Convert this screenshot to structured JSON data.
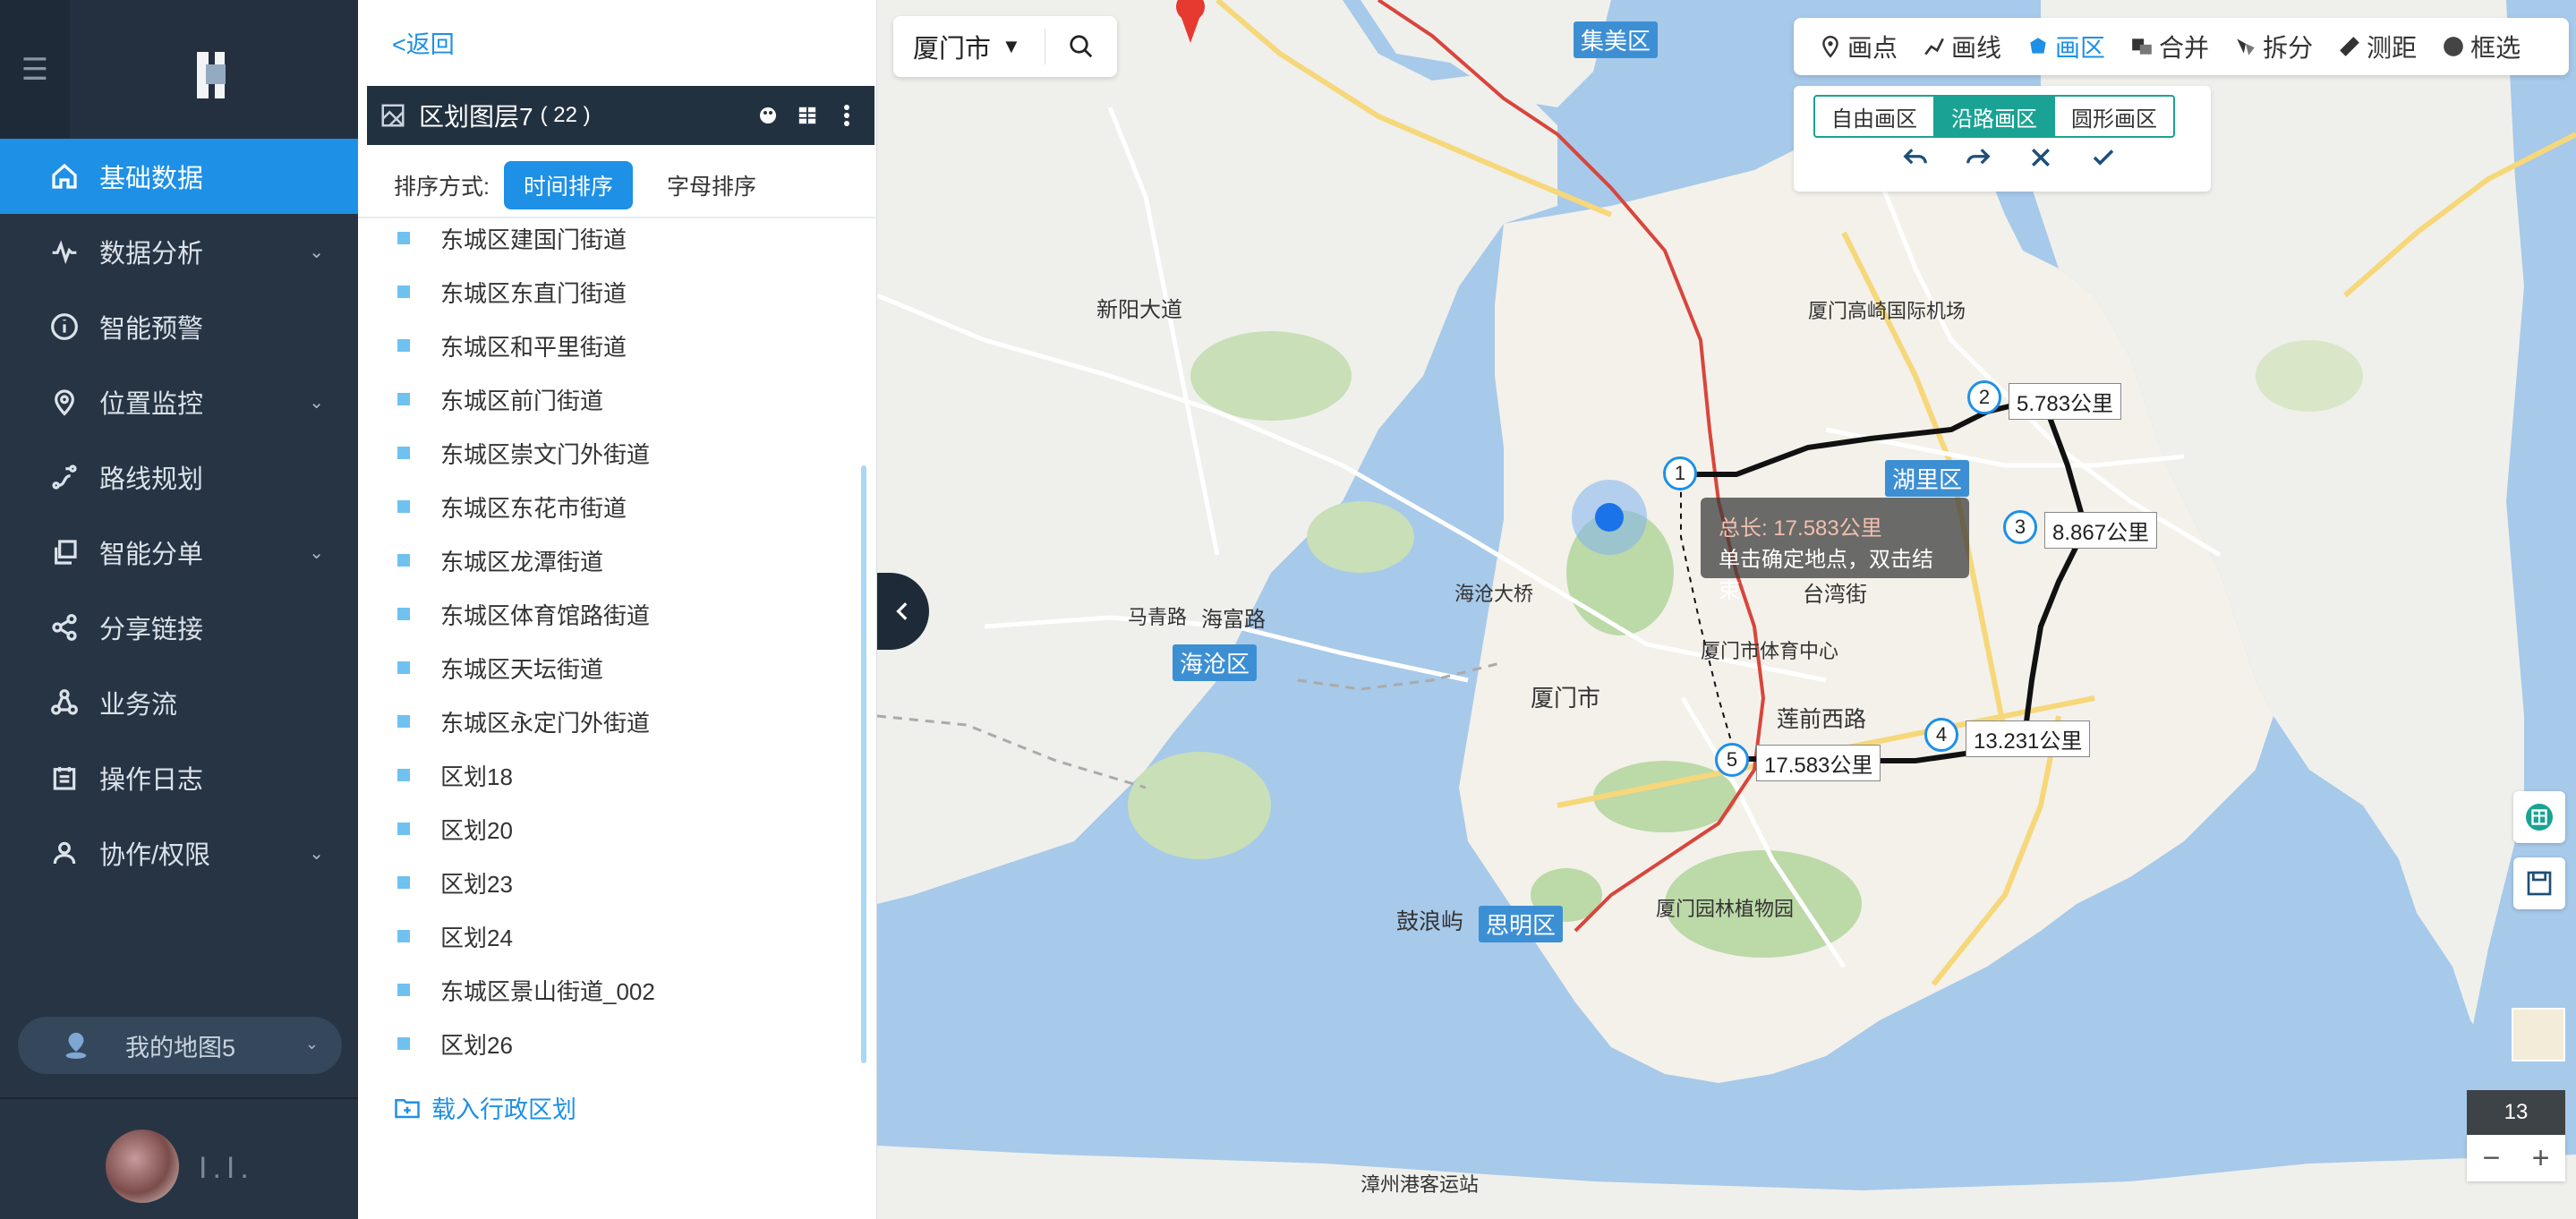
{
  "sidebar": {
    "items": [
      {
        "label": "基础数据",
        "icon": "home-icon"
      },
      {
        "label": "数据分析",
        "icon": "activity-icon"
      },
      {
        "label": "智能预警",
        "icon": "info-icon"
      },
      {
        "label": "位置监控",
        "icon": "location-pin-icon"
      },
      {
        "label": "路线规划",
        "icon": "route-icon"
      },
      {
        "label": "智能分单",
        "icon": "copy-icon"
      },
      {
        "label": "分享链接",
        "icon": "share-icon"
      },
      {
        "label": "业务流",
        "icon": "workflow-icon"
      },
      {
        "label": "操作日志",
        "icon": "calendar-icon"
      },
      {
        "label": "协作/权限",
        "icon": "user-icon"
      }
    ],
    "my_map": "我的地图5",
    "user_name": "I.I."
  },
  "panel": {
    "back": "<返回",
    "layer_title": "区划图层7",
    "layer_count": "( 22 )",
    "sort_label": "排序方式:",
    "sort_time": "时间排序",
    "sort_alpha": "字母排序",
    "regions": [
      "东城区建国门街道",
      "东城区东直门街道",
      "东城区和平里街道",
      "东城区前门街道",
      "东城区崇文门外街道",
      "东城区东花市街道",
      "东城区龙潭街道",
      "东城区体育馆路街道",
      "东城区天坛街道",
      "东城区永定门外街道",
      "区划18",
      "区划20",
      "区划23",
      "区划24",
      "东城区景山街道_002",
      "区划26"
    ],
    "load_link": "载入行政区划"
  },
  "map": {
    "city": "厦门市",
    "tools": [
      {
        "label": "画点",
        "icon": "point-icon"
      },
      {
        "label": "画线",
        "icon": "line-icon"
      },
      {
        "label": "画区",
        "icon": "polygon-icon"
      },
      {
        "label": "合并",
        "icon": "merge-icon"
      },
      {
        "label": "拆分",
        "icon": "split-icon"
      },
      {
        "label": "测距",
        "icon": "ruler-icon"
      },
      {
        "label": "框选",
        "icon": "box-select-icon"
      }
    ],
    "modes": [
      "自由画区",
      "沿路画区",
      "圆形画区"
    ],
    "tooltip": {
      "line1": "总长: 17.583公里",
      "line2": "单击确定地点，双击结束"
    },
    "nodes": [
      {
        "n": "1",
        "dist": ""
      },
      {
        "n": "2",
        "dist": "5.783公里"
      },
      {
        "n": "3",
        "dist": "8.867公里"
      },
      {
        "n": "4",
        "dist": "13.231公里"
      },
      {
        "n": "5",
        "dist": "17.583公里"
      }
    ],
    "zoom": "13",
    "labels": {
      "district_huli": "湖里区",
      "district_siming": "思明区",
      "district_haicang": "海沧区",
      "district_jimei": "集美区",
      "xiamen": "厦门市",
      "airport": "厦门高崎国际机场",
      "gulangyu": "鼓浪屿",
      "haicang_bridge": "海沧大桥",
      "lianqian": "莲前西路",
      "taiwan_st": "台湾街",
      "xinyang": "新阳大道",
      "haifu": "海富路",
      "maqing": "马青路",
      "sports": "厦门市体育中心",
      "botanical": "厦门园林植物园",
      "zhangzhou_pier": "漳州港客运站",
      "kaida": "湖里区"
    }
  }
}
